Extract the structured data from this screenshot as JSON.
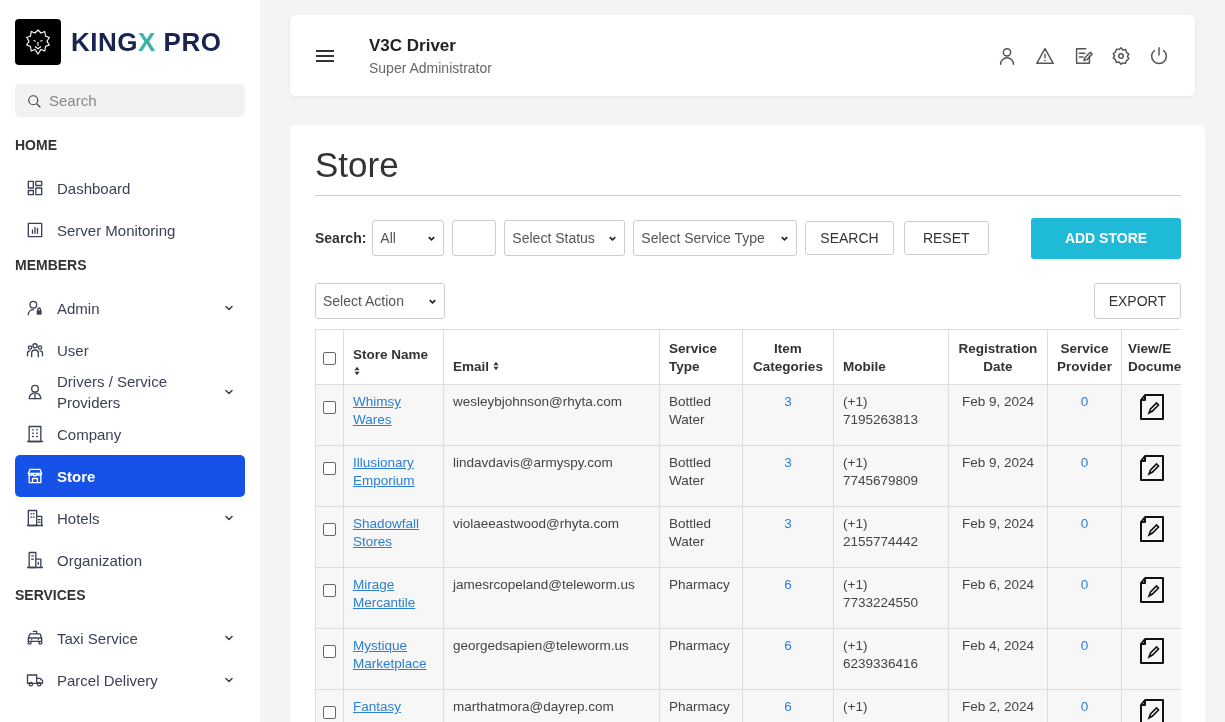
{
  "brand": {
    "lead": "KING",
    "accent": "X",
    "tail": "PRO"
  },
  "sidebar": {
    "search": {
      "placeholder": "Search"
    },
    "sections": [
      {
        "heading": "HOME",
        "items": [
          {
            "label": "Dashboard",
            "kind": "dashboard",
            "expandable": false,
            "selected": false
          },
          {
            "label": "Server Monitoring",
            "kind": "chart",
            "expandable": false,
            "selected": false
          }
        ]
      },
      {
        "heading": "MEMBERS",
        "items": [
          {
            "label": "Admin",
            "kind": "admin",
            "expandable": true,
            "selected": false
          },
          {
            "label": "User",
            "kind": "users",
            "expandable": false,
            "selected": false
          },
          {
            "label": "Drivers / Service Providers",
            "kind": "driver",
            "expandable": true,
            "selected": false
          },
          {
            "label": "Company",
            "kind": "building",
            "expandable": false,
            "selected": false
          },
          {
            "label": "Store",
            "kind": "store",
            "expandable": false,
            "selected": true
          },
          {
            "label": "Hotels",
            "kind": "hotel",
            "expandable": true,
            "selected": false
          },
          {
            "label": "Organization",
            "kind": "org",
            "expandable": false,
            "selected": false
          }
        ]
      },
      {
        "heading": "SERVICES",
        "items": [
          {
            "label": "Taxi Service",
            "kind": "taxi",
            "expandable": true,
            "selected": false
          },
          {
            "label": "Parcel Delivery",
            "kind": "truck",
            "expandable": true,
            "selected": false
          }
        ]
      }
    ]
  },
  "header": {
    "title": "V3C Driver",
    "subtitle": "Super Administrator",
    "actions": [
      {
        "kind": "user"
      },
      {
        "kind": "alert"
      },
      {
        "kind": "edit"
      },
      {
        "kind": "settings"
      },
      {
        "kind": "power"
      }
    ]
  },
  "page": {
    "title": "Store",
    "filters": {
      "label": "Search:",
      "controls": [
        {
          "kind": "select",
          "value": "All"
        },
        {
          "kind": "input"
        },
        {
          "kind": "select",
          "value": "Select Status"
        },
        {
          "kind": "select",
          "value": "Select Service Type"
        }
      ],
      "buttons": [
        "SEARCH",
        "RESET"
      ],
      "add_button": "ADD STORE"
    },
    "action_select": "Select Action",
    "export_button": "EXPORT",
    "table": {
      "select_all_checked": false,
      "columns": [
        {
          "label": "Store Name",
          "sortable": true
        },
        {
          "label": "Email",
          "sortable": true
        },
        {
          "label": "Service Type",
          "sortable": false
        },
        {
          "label": "Item Categories",
          "sortable": false
        },
        {
          "label": "Mobile",
          "sortable": false
        },
        {
          "label": "Registration Date",
          "sortable": false
        },
        {
          "label": "Service Provider",
          "sortable": false
        },
        {
          "label": "View/E Docume",
          "sortable": false
        }
      ],
      "rows": [
        {
          "checked": false,
          "store_name": "Whimsy Wares",
          "email": "wesleybjohnson@rhyta.com",
          "service_type": "Bottled Water",
          "item_categories": "3",
          "mobile": "(+1) 7195263813",
          "registration_date": "Feb 9, 2024",
          "service_provider": "0"
        },
        {
          "checked": false,
          "store_name": "Illusionary Emporium",
          "email": "lindavdavis@armyspy.com",
          "service_type": "Bottled Water",
          "item_categories": "3",
          "mobile": "(+1) 7745679809",
          "registration_date": "Feb 9, 2024",
          "service_provider": "0"
        },
        {
          "checked": false,
          "store_name": "Shadowfall Stores",
          "email": "violaeeastwood@rhyta.com",
          "service_type": "Bottled Water",
          "item_categories": "3",
          "mobile": "(+1) 2155774442",
          "registration_date": "Feb 9, 2024",
          "service_provider": "0"
        },
        {
          "checked": false,
          "store_name": "Mirage Mercantile",
          "email": "jamesrcopeland@teleworm.us",
          "service_type": "Pharmacy",
          "item_categories": "6",
          "mobile": "(+1) 7733224550",
          "registration_date": "Feb 6, 2024",
          "service_provider": "0"
        },
        {
          "checked": false,
          "store_name": "Mystique Marketplace",
          "email": "georgedsapien@teleworm.us",
          "service_type": "Pharmacy",
          "item_categories": "6",
          "mobile": "(+1) 6239336416",
          "registration_date": "Feb 4, 2024",
          "service_provider": "0"
        },
        {
          "checked": false,
          "store_name": "Fantasy",
          "email": "marthatmora@dayrep.com",
          "service_type": "Pharmacy",
          "item_categories": "6",
          "mobile": "(+1)",
          "registration_date": "Feb 2, 2024",
          "service_provider": "0"
        }
      ]
    }
  }
}
